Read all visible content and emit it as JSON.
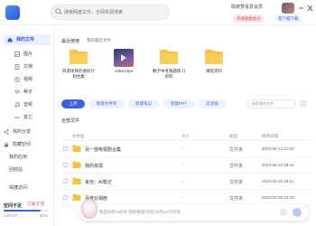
{
  "topbar": {
    "search_placeholder": "搜索网盘文件，全网资源搜索",
    "username": "陈晓梦喜爱会员",
    "vip_label": "开通超级会员",
    "client_label": "客户端下载"
  },
  "sidebar": {
    "items": [
      {
        "label": "我的文件",
        "icon": "home-icon",
        "active": true
      },
      {
        "label": "图片",
        "icon": "image-icon"
      },
      {
        "label": "文档",
        "icon": "doc-icon"
      },
      {
        "label": "视频",
        "icon": "video-icon"
      },
      {
        "label": "种子",
        "icon": "bt-icon"
      },
      {
        "label": "音频",
        "icon": "audio-icon"
      },
      {
        "label": "其它",
        "icon": "more-icon"
      },
      {
        "label": "我的分享",
        "icon": "share-icon"
      },
      {
        "label": "隐藏空间",
        "icon": "lock-icon"
      },
      {
        "label": "我的应用"
      },
      {
        "label": "回收站"
      },
      {
        "label": "快捷访问"
      }
    ],
    "storage": {
      "label": "空间不足",
      "badge": "已满 扩容",
      "used_text": "1.6T/2T",
      "percent_text": "81%",
      "percent": 81
    }
  },
  "main": {
    "recent_title": "最近使用",
    "recent_toggle": "我的最近文件",
    "recent": [
      {
        "name": "开源项目的进阶计划合集",
        "kind": "folder"
      },
      {
        "name": "1454.mp4",
        "kind": "video"
      },
      {
        "name": "数学中考真题练习资料",
        "kind": "folder"
      },
      {
        "name": "课程资料",
        "kind": "folder"
      }
    ],
    "toolbar": {
      "upload": "上传",
      "new_folder": "新建文件夹",
      "new_note": "新建笔记",
      "new_ppt": "智能PPT",
      "cloud": "云添加",
      "filter_placeholder": "搜索我的文件"
    },
    "all_files_title": "全部文件",
    "columns": {
      "name": "文件名",
      "size": "大小",
      "type": "类型",
      "date": "修改日期"
    },
    "files": [
      {
        "name": "另一部电视剧合集",
        "size": "-",
        "type": "文件夹",
        "date": "2023-06-14 21:03"
      },
      {
        "name": "我的资源",
        "size": "-",
        "type": "文件夹",
        "date": "2023-06-12 08:24"
      },
      {
        "name": "来自：AI笔记",
        "size": "-",
        "type": "文件夹",
        "date": "2023-03-20 19:11"
      },
      {
        "name": "百度云相册",
        "size": "-",
        "type": "文件夹",
        "date": "2023-03-25 23:20"
      }
    ],
    "assistant": {
      "placeholder": "我是你的AI助手 帮你整理/问答/创作/AI写作等…"
    }
  },
  "colors": {
    "accent": "#3a64d8",
    "folder": "#f7c244",
    "vip": "#e34b4b"
  }
}
